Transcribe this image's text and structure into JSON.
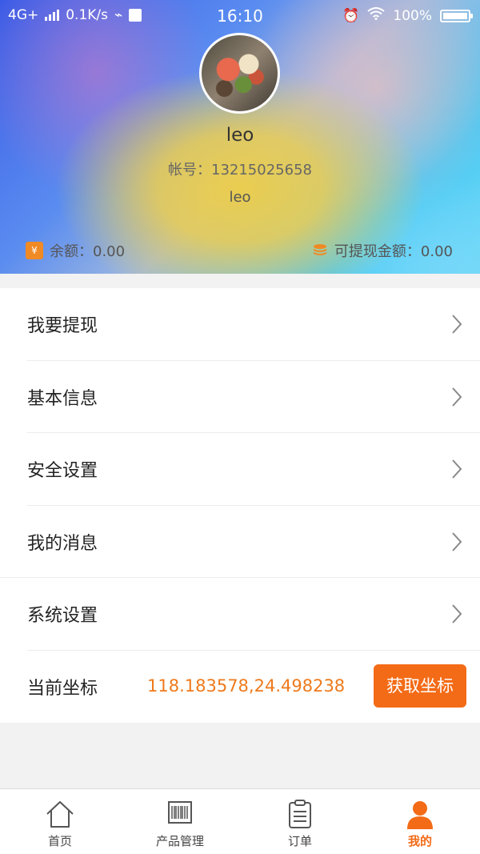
{
  "status_bar": {
    "network": "4G+",
    "speed": "0.1K/s",
    "time": "16:10",
    "battery": "100%"
  },
  "profile": {
    "name": "leo",
    "account_label": "帐号：13215025658",
    "nickname": "leo",
    "balance_label": "余额：0.00",
    "withdrawable_label": "可提现金额：0.00"
  },
  "menu": [
    {
      "label": "我要提现"
    },
    {
      "label": "基本信息"
    },
    {
      "label": "安全设置"
    },
    {
      "label": "我的消息"
    },
    {
      "label": "系统设置"
    }
  ],
  "coordinate": {
    "label": "当前坐标",
    "value": "118.183578,24.498238",
    "button": "获取坐标"
  },
  "tabs": [
    {
      "label": "首页",
      "icon": "home-icon"
    },
    {
      "label": "产品管理",
      "icon": "barcode-icon"
    },
    {
      "label": "订单",
      "icon": "clipboard-icon"
    },
    {
      "label": "我的",
      "icon": "user-icon"
    }
  ],
  "colors": {
    "accent": "#f36b17",
    "coordinate_text": "#ee7a1c"
  }
}
